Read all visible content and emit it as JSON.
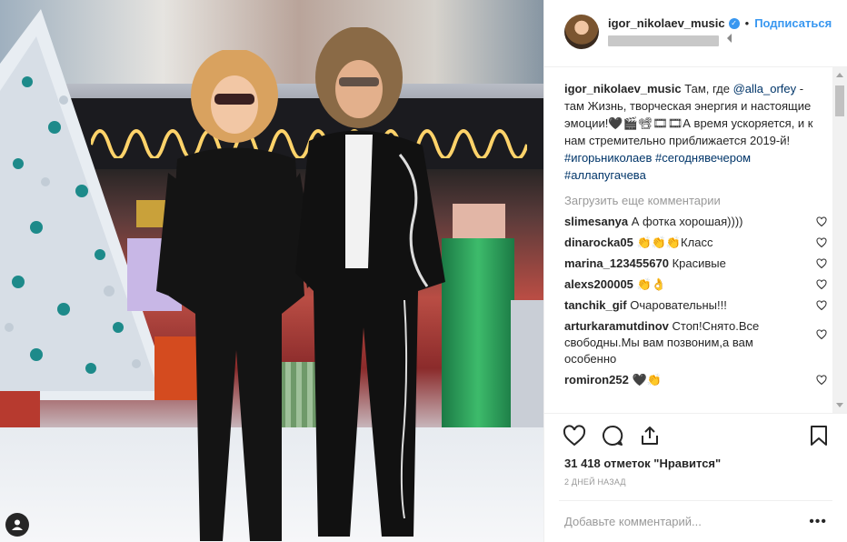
{
  "post": {
    "username": "igor_nikolaev_music",
    "follow_label": "Подписаться",
    "caption": {
      "username": "igor_nikolaev_music",
      "text_before_mention": " Там, где ",
      "mention": "@alla_orfey",
      "text_after_mention": " - там Жизнь, творческая энергия и настоящие эмоции!🖤🎬📽🎞🎞А время ускоряется, и к нам стремительно приближается 2019-й!",
      "hashtags": [
        "#игорьниколаев",
        "#сегоднявечером",
        "#аллапугачева"
      ]
    },
    "load_more_label": "Загрузить еще комментарии",
    "comments": [
      {
        "user": "slimesanya",
        "text": "А фотка хорошая))))"
      },
      {
        "user": "dinarocka05",
        "text": "👏👏👏Класс"
      },
      {
        "user": "marina_123455670",
        "text": "Красивые"
      },
      {
        "user": "alexs200005",
        "text": "👏👌"
      },
      {
        "user": "tanchik_gif",
        "text": "Очаровательны!!!"
      },
      {
        "user": "arturkaramutdinov",
        "text": "Стоп!Снято.Все свободны.Мы вам позвоним,а вам особенно"
      },
      {
        "user": "romiron252",
        "text": "🖤👏"
      }
    ],
    "likes_label": "31 418 отметок \"Нравится\"",
    "date_label": "2 ДНЕЙ НАЗАД",
    "add_comment_placeholder": "Добавьте комментарий...",
    "more_label": "•••"
  },
  "icons": {
    "verified": "verified-badge-icon",
    "like": "heart-icon",
    "comment": "comment-icon",
    "share": "share-icon",
    "save": "bookmark-icon",
    "user_tag": "user-tag-icon"
  },
  "colors": {
    "link": "#3897f0",
    "mention": "#003569",
    "muted": "#999999",
    "text": "#262626"
  }
}
